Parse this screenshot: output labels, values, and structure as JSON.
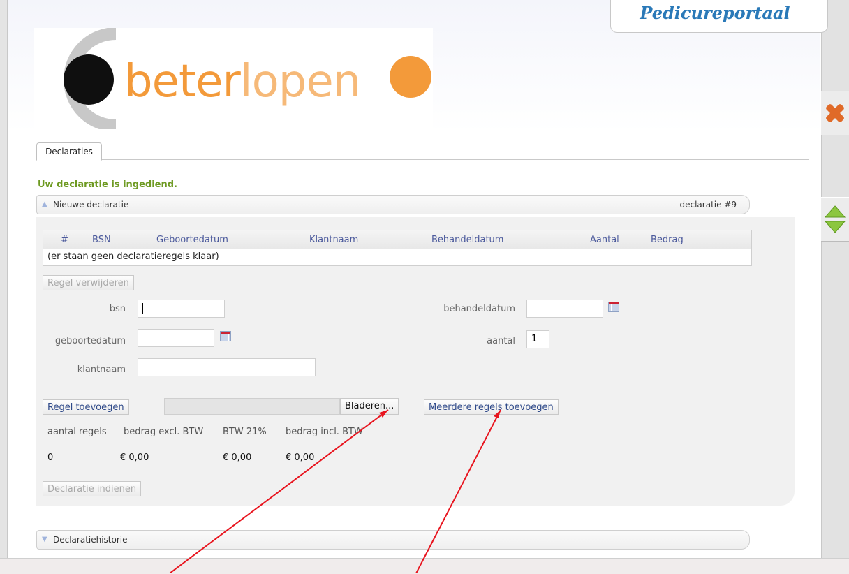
{
  "portal": {
    "title": "Pedicureportaal"
  },
  "logo": {
    "text_bold": "beter",
    "text_light": "lopen",
    "colors": {
      "bold": "#f39a3a",
      "light": "#f6b978",
      "ring": "#c8c8c8",
      "dot_dark": "#0f0f0f",
      "dot_orange": "#f39a3a"
    }
  },
  "tabs": [
    {
      "label": "Declaraties"
    }
  ],
  "message": {
    "success": "Uw declaratie is ingediend."
  },
  "new_declaration": {
    "title": "Nieuwe declaratie",
    "number": "declaratie #9",
    "table": {
      "columns": [
        "#",
        "BSN",
        "Geboortedatum",
        "Klantnaam",
        "Behandeldatum",
        "Aantal",
        "Bedrag"
      ],
      "empty_text": "(er staan geen declaratieregels klaar)"
    },
    "remove_button": "Regel verwijderen",
    "form": {
      "bsn": {
        "label": "bsn",
        "value": ""
      },
      "geboortedatum": {
        "label": "geboortedatum",
        "value": ""
      },
      "klantnaam": {
        "label": "klantnaam",
        "value": ""
      },
      "behandeldatum": {
        "label": "behandeldatum",
        "value": ""
      },
      "aantal": {
        "label": "aantal",
        "value": "1"
      }
    },
    "add_button": "Regel toevoegen",
    "file": {
      "value": "",
      "browse_button": "Bladeren..."
    },
    "multi_button": "Meerdere regels toevoegen",
    "summary": {
      "headers": [
        "aantal regels",
        "bedrag excl. BTW",
        "BTW 21%",
        "bedrag incl. BTW"
      ],
      "values": [
        "0",
        "€ 0,00",
        "€ 0,00",
        "€ 0,00"
      ]
    },
    "submit_button": "Declaratie indienen"
  },
  "history": {
    "title": "Declaratiehistorie"
  },
  "side_icons": [
    "close-icon",
    "up-down-arrows-icon"
  ],
  "annotation": {
    "arrow_color": "#e8141e"
  }
}
